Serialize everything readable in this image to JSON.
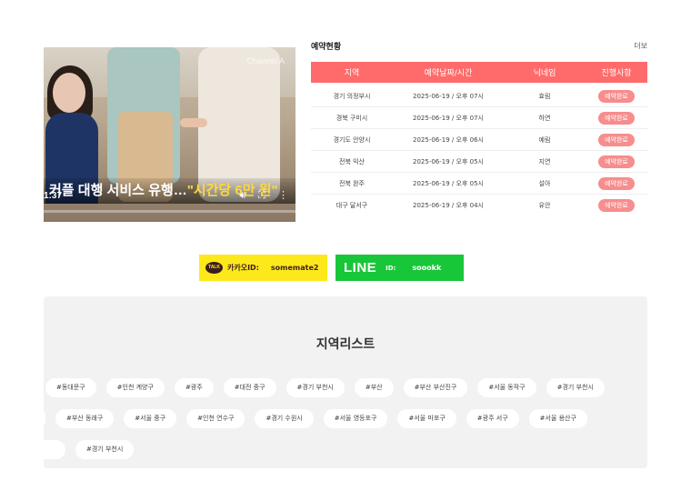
{
  "video": {
    "watermark": "Channel A",
    "caption_white": "커플 대행 서비스 유행…",
    "caption_yellow": "\"시간당 6만 원\"",
    "time": "1:37",
    "progress": 0.0
  },
  "reservation": {
    "title": "예약현황",
    "more": "더보",
    "headers": [
      "지역",
      "예약날짜/시간",
      "닉네임",
      "진행사항"
    ],
    "rows": [
      {
        "region": "경기 의정부시",
        "datetime": "2025-06-19 / 오후 07시",
        "nick": "효림",
        "status": "예약완료"
      },
      {
        "region": "경북 구미시",
        "datetime": "2025-06-19 / 오후 07시",
        "nick": "하연",
        "status": "예약완료"
      },
      {
        "region": "경기도 안양시",
        "datetime": "2025-06-19 / 오후 06시",
        "nick": "예림",
        "status": "예약완료"
      },
      {
        "region": "전북 익산",
        "datetime": "2025-06-19 / 오후 05시",
        "nick": "지연",
        "status": "예약완료"
      },
      {
        "region": "전북 완주",
        "datetime": "2025-06-19 / 오후 05시",
        "nick": "설아",
        "status": "예약완료"
      },
      {
        "region": "대구 달서구",
        "datetime": "2025-06-19 / 오후 04시",
        "nick": "유안",
        "status": "예약완료"
      }
    ],
    "colors": {
      "header_bg": "#ff6b6b",
      "badge_bg": "#f78d8d"
    }
  },
  "kakao": {
    "talk": "TALK",
    "label": "카카오ID:",
    "id": "somemate2",
    "color": "#fde91b"
  },
  "line": {
    "logo": "LINE",
    "label": "ID:",
    "id": "soookk",
    "color": "#18c639"
  },
  "regions": {
    "title": "지역리스트",
    "row1": [
      "#동대문구",
      "#인천 계양구",
      "#광주",
      "#대전 중구",
      "#경기 부천시",
      "#부산",
      "#부산 부산진구",
      "#서울 동작구",
      "#경기 부천시"
    ],
    "row2": [
      "#부산 동래구",
      "#서울 중구",
      "#인천 연수구",
      "#경기 수원시",
      "#서울 영등포구",
      "#서울 마포구",
      "#광주 서구",
      "#서울 용산구"
    ],
    "row3": [
      "#경기 부천시"
    ]
  }
}
